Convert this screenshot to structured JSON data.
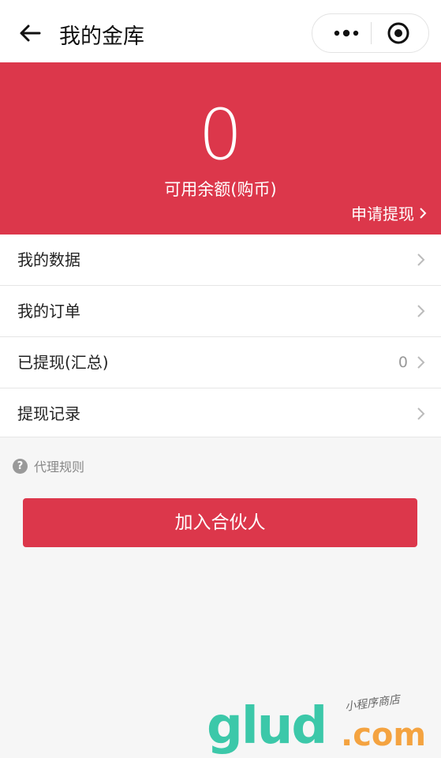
{
  "nav": {
    "title": "我的金库"
  },
  "hero": {
    "amount": "0",
    "amount_label": "可用余额(购币)",
    "withdraw_label": "申请提现"
  },
  "menu": [
    {
      "label": "我的数据",
      "value": ""
    },
    {
      "label": "我的订单",
      "value": ""
    },
    {
      "label": "已提现(汇总)",
      "value": "0"
    },
    {
      "label": "提现记录",
      "value": ""
    }
  ],
  "rules": {
    "label": "代理规则"
  },
  "join_button": {
    "label": "加入合伙人"
  },
  "watermark": {
    "brand": "glud",
    "domain": ".com",
    "caption": "小程序商店"
  },
  "colors": {
    "accent": "#dc374b",
    "background": "#f6f6f6"
  }
}
